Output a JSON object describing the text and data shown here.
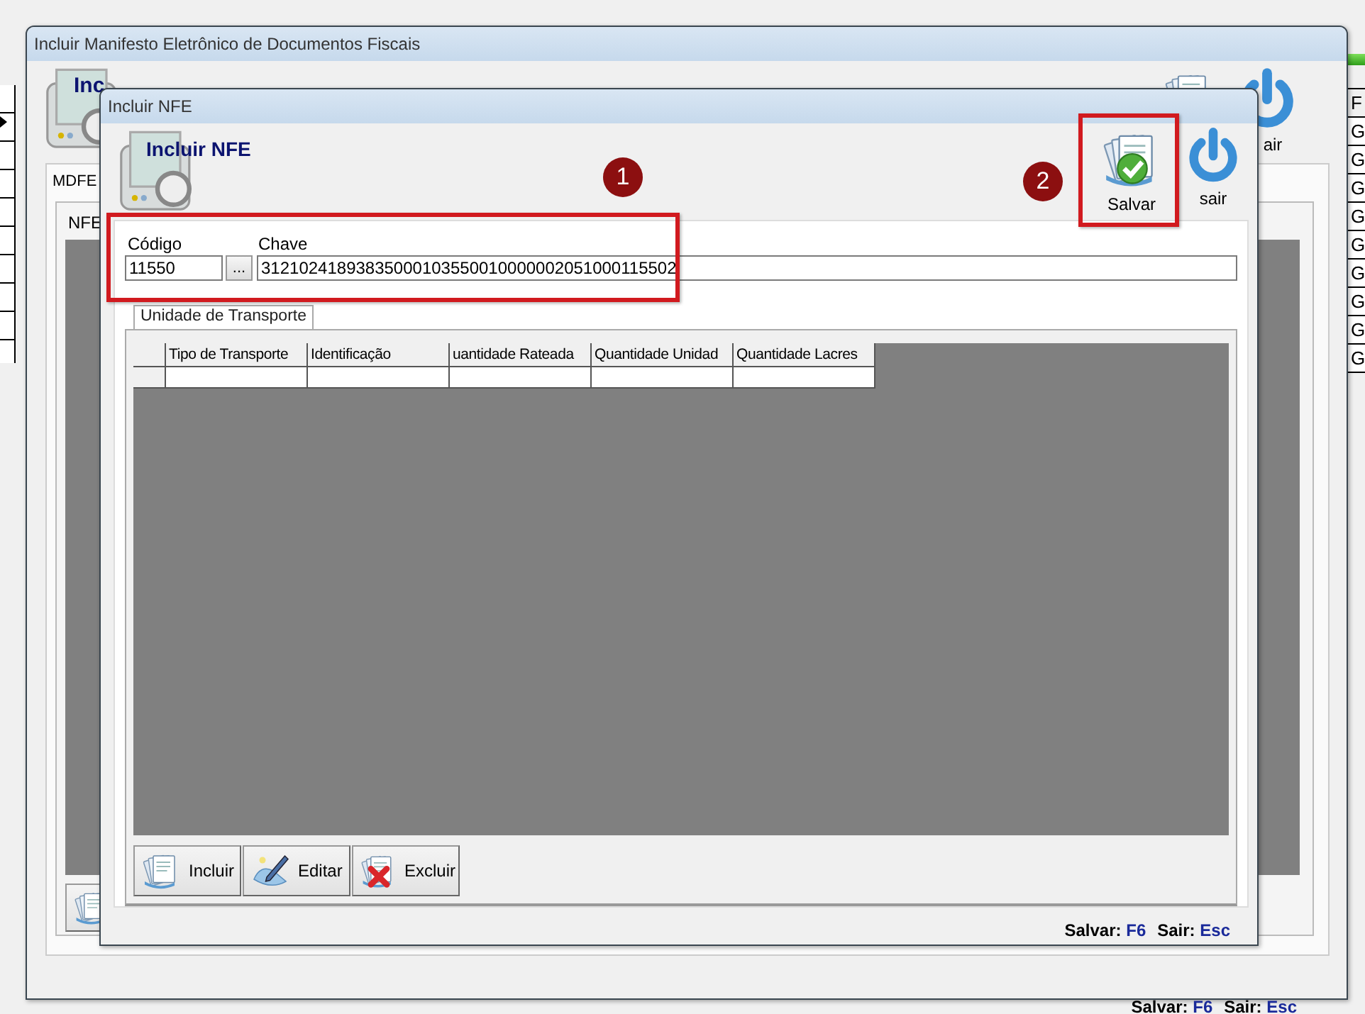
{
  "background_list": {
    "header": "F",
    "cells": [
      "G",
      "G",
      "G",
      "G",
      "G",
      "G",
      "G",
      "G",
      "G"
    ]
  },
  "main_window": {
    "title": "Incluir Manifesto Eletrônico de Documentos Fiscais",
    "heading": "Inc",
    "toolbar": [
      {
        "kind": "exit",
        "label": "air"
      }
    ],
    "tabs": [
      {
        "label": "MDFE"
      }
    ],
    "sub_tabs": [
      {
        "label": "NFE"
      }
    ],
    "shortcuts": [
      {
        "label": "Salvar:",
        "key": "F6"
      },
      {
        "label": "Sair:",
        "key": "Esc"
      }
    ]
  },
  "dialog": {
    "title": "Incluir NFE",
    "heading": "Incluir NFE",
    "toolbar": [
      {
        "kind": "save",
        "label": "Salvar"
      },
      {
        "kind": "exit",
        "label": "sair"
      }
    ],
    "codigo": {
      "label": "Código",
      "value": "11550"
    },
    "lookup_button": "...",
    "chave": {
      "label": "Chave",
      "value": "31210241893835000103550010000002051000115502"
    },
    "tabs": [
      {
        "label": "Unidade de Transporte"
      }
    ],
    "table": {
      "columns": [
        "Tipo de Transporte",
        "Identificação",
        "uantidade Rateada",
        "Quantidade Unidad",
        "Quantidade Lacres"
      ]
    },
    "buttons": [
      {
        "kind": "add",
        "label": "Incluir"
      },
      {
        "kind": "edit",
        "label": "Editar"
      },
      {
        "kind": "delete",
        "label": "Excluir"
      }
    ],
    "shortcuts": [
      {
        "label": "Salvar:",
        "key": "F6"
      },
      {
        "label": "Sair:",
        "key": "Esc"
      }
    ]
  },
  "annotations": [
    {
      "number": "1"
    },
    {
      "number": "2"
    }
  ]
}
